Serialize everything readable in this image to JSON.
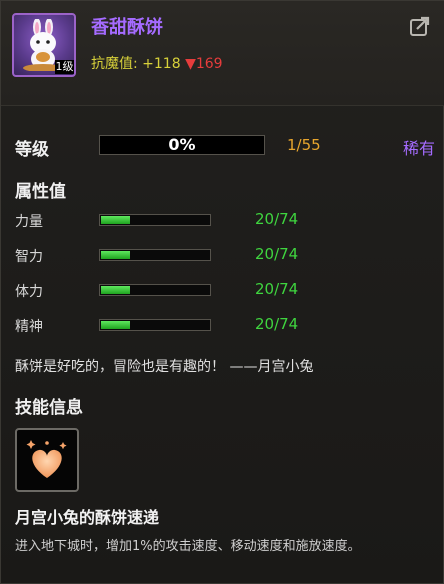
{
  "item": {
    "name": "香甜酥饼",
    "avatar_level": "1级",
    "resist_label": "抗魔值:",
    "resist_plus": "+118",
    "resist_minus": "▼169"
  },
  "level": {
    "label": "等级",
    "progress_text": "0%",
    "progress": 0,
    "count": "1/55",
    "rarity": "稀有"
  },
  "attributes": {
    "title": "属性值",
    "items": [
      {
        "name": "力量",
        "value": "20/74",
        "fraction": 0.27
      },
      {
        "name": "智力",
        "value": "20/74",
        "fraction": 0.27
      },
      {
        "name": "体力",
        "value": "20/74",
        "fraction": 0.27
      },
      {
        "name": "精神",
        "value": "20/74",
        "fraction": 0.27
      }
    ]
  },
  "quote": "酥饼是好吃的，冒险也是有趣的！ ——月宫小兔",
  "skill": {
    "title": "技能信息",
    "name": "月宫小兔的酥饼速递",
    "description": "进入地下城时，增加1%的攻击速度、移动速度和施放速度。"
  },
  "colors": {
    "title_purple": "#a56bff",
    "level_orange": "#e7a52d",
    "attr_green": "#3fd53f",
    "minus_red": "#e63c3c",
    "resist_yellow": "#d8d13a"
  },
  "icons": {
    "export": "export-icon",
    "avatar": "rabbit-avatar-icon",
    "skill": "heart-icon"
  }
}
